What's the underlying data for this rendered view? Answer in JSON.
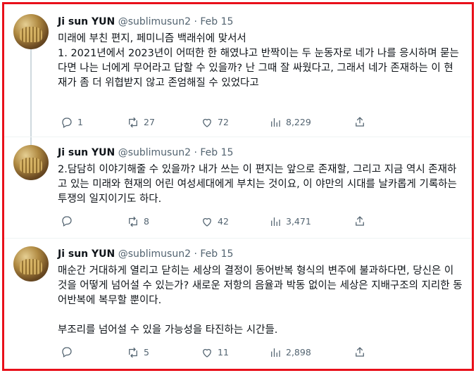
{
  "tweets": [
    {
      "name": "Ji sun YUN",
      "handle": "@sublimusun2",
      "dot": "·",
      "date": "Feb 15",
      "text": "미래에 부친 편지, 페미니즘 백래쉬에 맞서서\n1. 2021년에서 2023년이 어떠한 한 해였냐고 반짝이는 두 눈동자로 네가 나를 응시하며 묻는다면 나는 너에게 무어라고 답할 수 있을까? 난 그때 잘 싸웠다고, 그래서 네가 존재하는 이 현재가 좀 더 위협받지 않고 존엄해질 수 있었다고",
      "replies": "1",
      "retweets": "27",
      "likes": "72",
      "views": "8,229"
    },
    {
      "name": "Ji sun YUN",
      "handle": "@sublimusun2",
      "dot": "·",
      "date": "Feb 15",
      "text": "2.담담히 이야기해줄 수 있을까? 내가 쓰는 이 편지는 앞으로 존재할, 그리고 지금 역시 존재하고 있는 미래와 현재의 어린 여성세대에게 부치는 것이요, 이 야만의 시대를 날카롭게 기록하는 투쟁의 일지이기도 하다.",
      "replies": "",
      "retweets": "8",
      "likes": "42",
      "views": "3,471"
    },
    {
      "name": "Ji sun YUN",
      "handle": "@sublimusun2",
      "dot": "·",
      "date": "Feb 15",
      "text": "매순간 거대하게 열리고 닫히는 세상의 결정이 동어반복 형식의 변주에 불과하다면, 당신은 이것을 어떻게 넘어설 수 있는가? 새로운 저항의 음율과 박동 없이는 세상은 지배구조의 지리한 동어반복에 복무할 뿐이다.\n\n부조리를 넘어설 수 있을 가능성을 타진하는 시간들.",
      "replies": "",
      "retweets": "5",
      "likes": "11",
      "views": "2,898"
    }
  ],
  "icons": {
    "reply": "reply-icon",
    "retweet": "retweet-icon",
    "like": "heart-icon",
    "views": "views-icon",
    "share": "share-icon"
  },
  "colors": {
    "frame_border": "#e8101a",
    "muted_text": "#536471",
    "thread_line": "#cfd9de"
  }
}
